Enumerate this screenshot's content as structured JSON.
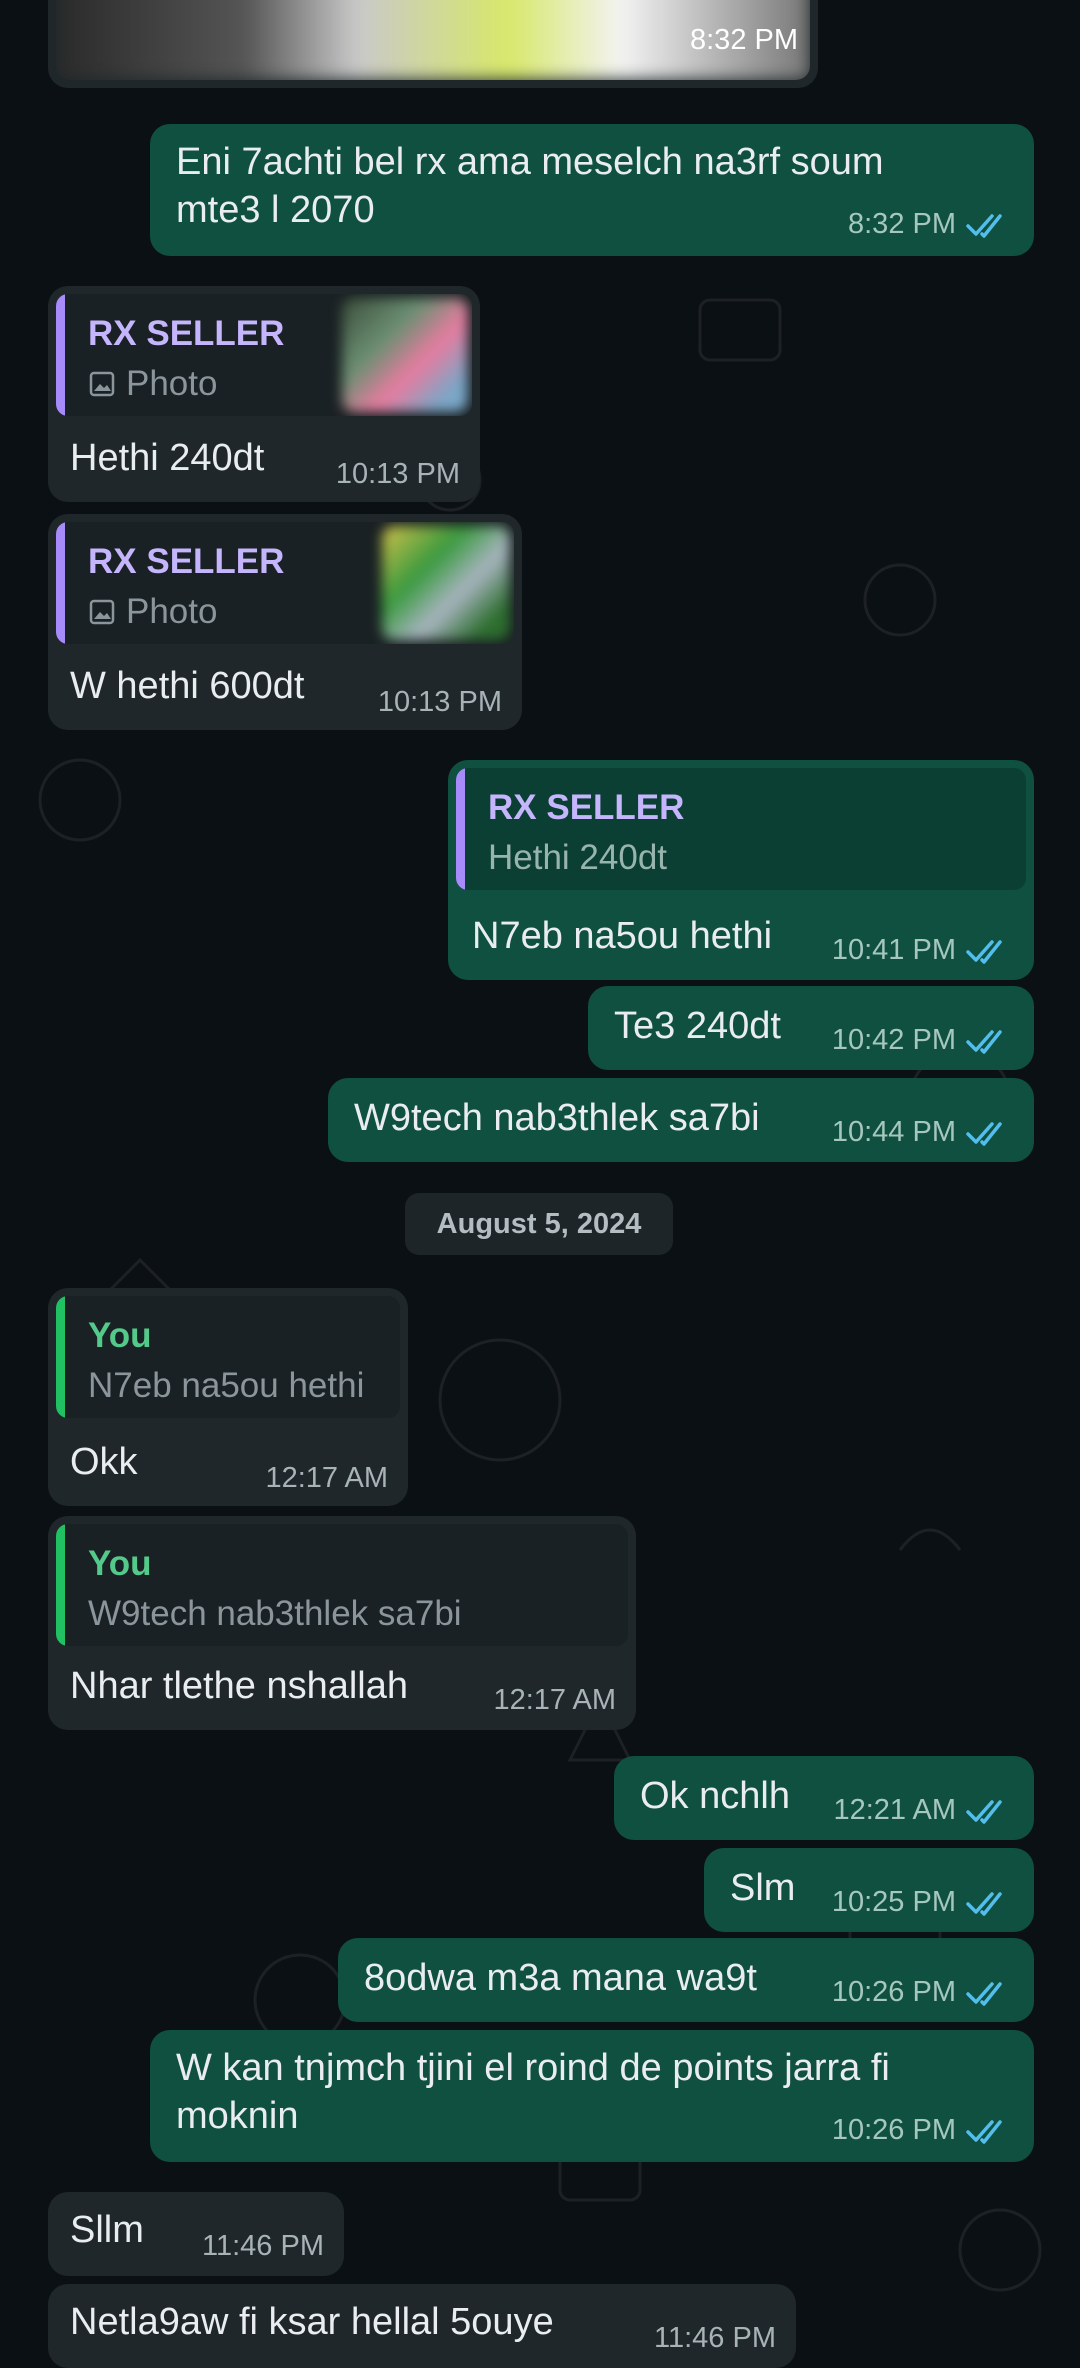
{
  "messages": {
    "m1": {
      "time": "8:32 PM"
    },
    "m2": {
      "text_line1": "Eni 7achti bel rx ama meselch na3rf soum",
      "text_line2": "mte3 l 2070",
      "time": "8:32 PM"
    },
    "m3": {
      "quote_author": "RX SELLER",
      "quote_text": "Photo",
      "text": "Hethi 240dt",
      "time": "10:13 PM"
    },
    "m4": {
      "quote_author": "RX SELLER",
      "quote_text": "Photo",
      "text": "W hethi 600dt",
      "time": "10:13 PM"
    },
    "m5": {
      "quote_author": "RX SELLER",
      "quote_text": "Hethi 240dt",
      "text": "N7eb na5ou hethi",
      "time": "10:41 PM"
    },
    "m6": {
      "text": "Te3 240dt",
      "time": "10:42 PM"
    },
    "m7": {
      "text": "W9tech nab3thlek sa7bi",
      "time": "10:44 PM"
    },
    "date_separator": "August 5, 2024",
    "m8": {
      "quote_author": "You",
      "quote_text": "N7eb na5ou hethi",
      "text": "Okk",
      "time": "12:17 AM"
    },
    "m9": {
      "quote_author": "You",
      "quote_text": "W9tech nab3thlek sa7bi",
      "text": "Nhar tlethe nshallah",
      "time": "12:17 AM"
    },
    "m10": {
      "text": "Ok nchlh",
      "time": "12:21 AM"
    },
    "m11": {
      "text": "Slm",
      "time": "10:25 PM"
    },
    "m12": {
      "text": "8odwa m3a mana wa9t",
      "time": "10:26 PM"
    },
    "m13": {
      "text_line1": "W kan tnjmch tjini el roind de points jarra fi",
      "text_line2": "moknin",
      "time": "10:26 PM"
    },
    "m14": {
      "text": "Sllm",
      "time": "11:46 PM"
    },
    "m15": {
      "text": "Netla9aw fi ksar hellal 5ouye",
      "time": "11:46 PM"
    }
  },
  "colors": {
    "background": "#0b1014",
    "incoming_bubble": "#1f272a",
    "outgoing_bubble": "#0f5040",
    "read_ticks": "#53bdeb",
    "seller_quote_bar": "#a78bfa",
    "seller_quote_name": "#c4b5fd",
    "you_quote_bar": "#21c063",
    "you_quote_name": "#53c98a"
  },
  "icons": {
    "read_receipt": "double-check-icon",
    "photo": "image-icon"
  }
}
